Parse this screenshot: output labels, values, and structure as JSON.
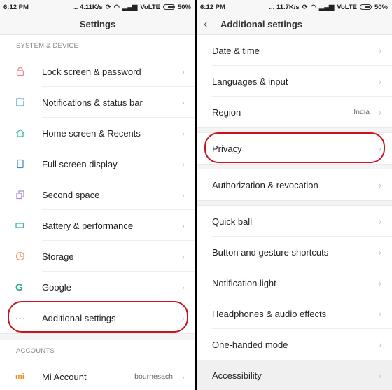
{
  "left": {
    "status": {
      "time": "6:12 PM",
      "speed": "... 4.11K/s",
      "network": "VoLTE",
      "battery": "50%"
    },
    "title": "Settings",
    "sections": [
      {
        "header": "SYSTEM & DEVICE",
        "items": [
          {
            "label": "Lock screen & password",
            "icon": "lock-icon",
            "color": "#e38a98"
          },
          {
            "label": "Notifications & status bar",
            "icon": "notification-icon",
            "color": "#4aa3d6"
          },
          {
            "label": "Home screen & Recents",
            "icon": "home-icon",
            "color": "#3ab8a4"
          },
          {
            "label": "Full screen display",
            "icon": "phone-icon",
            "color": "#3b8fd0"
          },
          {
            "label": "Second space",
            "icon": "second-space-icon",
            "color": "#a98be0"
          },
          {
            "label": "Battery & performance",
            "icon": "battery-icon",
            "color": "#3ab8a4"
          },
          {
            "label": "Storage",
            "icon": "storage-icon",
            "color": "#ef9b6b"
          },
          {
            "label": "Google",
            "icon": "google-icon",
            "color": "#2ea98f"
          },
          {
            "label": "Additional settings",
            "icon": "more-icon",
            "color": "#3aa0d8",
            "highlighted": true
          }
        ]
      },
      {
        "header": "ACCOUNTS",
        "items": [
          {
            "label": "Mi Account",
            "icon": "mi-icon",
            "color": "#f08a1c",
            "value": "bournesach"
          }
        ]
      }
    ]
  },
  "right": {
    "status": {
      "time": "6:12 PM",
      "speed": "... 11.7K/s",
      "network": "VoLTE",
      "battery": "50%"
    },
    "title": "Additional settings",
    "groups": [
      [
        {
          "label": "Date & time"
        },
        {
          "label": "Languages & input"
        },
        {
          "label": "Region",
          "value": "India"
        }
      ],
      [
        {
          "label": "Privacy",
          "highlighted": true
        }
      ],
      [
        {
          "label": "Authorization & revocation"
        }
      ],
      [
        {
          "label": "Quick ball"
        },
        {
          "label": "Button and gesture shortcuts"
        },
        {
          "label": "Notification light"
        },
        {
          "label": "Headphones & audio effects"
        },
        {
          "label": "One-handed mode"
        },
        {
          "label": "Accessibility",
          "pressed": true
        }
      ]
    ]
  },
  "annotation_color": "#c8141e",
  "chevron": "›"
}
